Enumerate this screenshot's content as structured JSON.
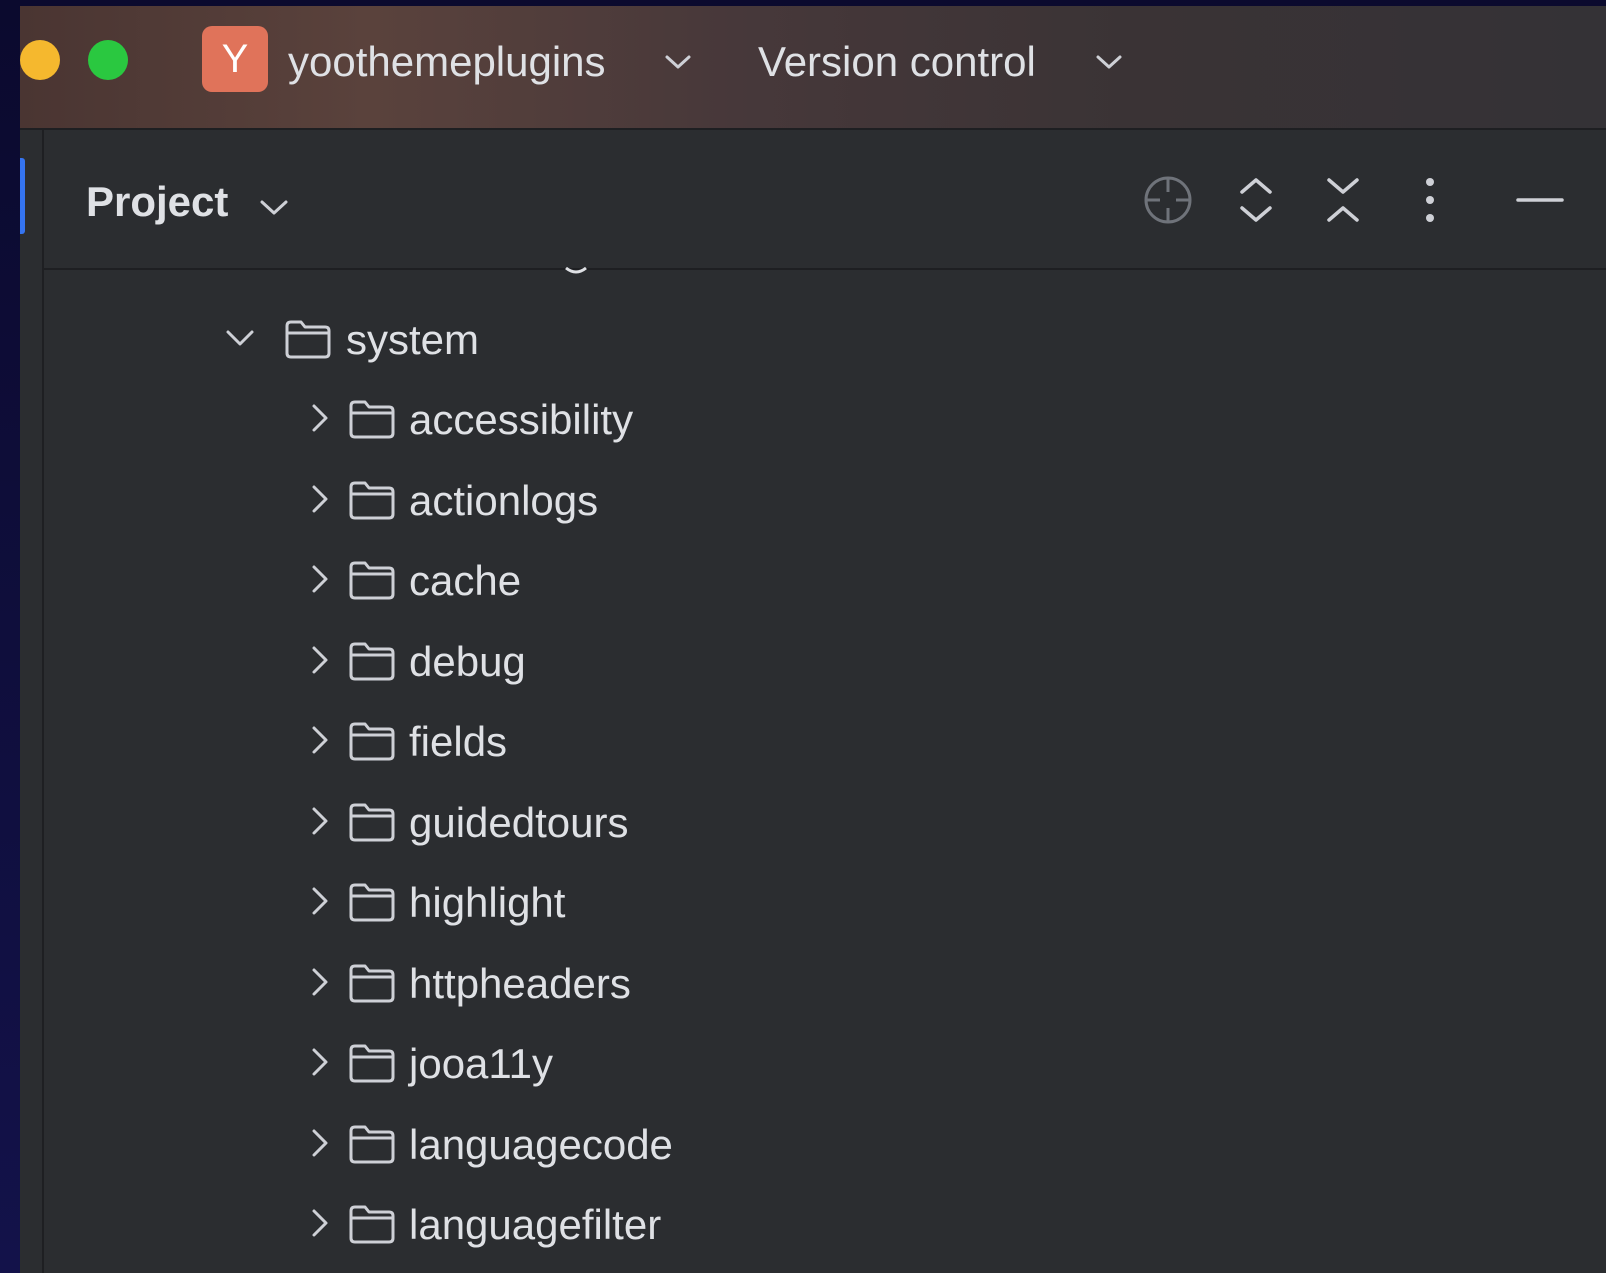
{
  "colors": {
    "window_bg": "#2b2d30",
    "text": "#dfe1e5",
    "icon": "#ced0d6",
    "badge": "#e0735a",
    "accent": "#3574f0",
    "traffic_yellow": "#f5b82e",
    "traffic_green": "#2ac840"
  },
  "titlebar": {
    "project_initial": "Y",
    "project_name": "yoothemeplugins",
    "project_chevron_icon": "chevron-down-icon",
    "vcs_label": "Version control",
    "vcs_chevron_icon": "chevron-down-icon"
  },
  "panel": {
    "title": "Project",
    "title_chevron_icon": "chevron-down-icon",
    "actions": [
      {
        "name": "locate-icon",
        "tooltip": ""
      },
      {
        "name": "expand-all-icon",
        "tooltip": ""
      },
      {
        "name": "collapse-all-icon",
        "tooltip": ""
      },
      {
        "name": "more-options-icon",
        "tooltip": ""
      },
      {
        "name": "minimize-icon",
        "tooltip": ""
      }
    ]
  },
  "tree": {
    "parent": {
      "label": "system",
      "expanded": true,
      "icon": "folder-icon"
    },
    "children": [
      {
        "label": "accessibility",
        "expanded": false
      },
      {
        "label": "actionlogs",
        "expanded": false
      },
      {
        "label": "cache",
        "expanded": false
      },
      {
        "label": "debug",
        "expanded": false
      },
      {
        "label": "fields",
        "expanded": false
      },
      {
        "label": "guidedtours",
        "expanded": false
      },
      {
        "label": "highlight",
        "expanded": false
      },
      {
        "label": "httpheaders",
        "expanded": false
      },
      {
        "label": "jooa11y",
        "expanded": false
      },
      {
        "label": "languagecode",
        "expanded": false
      },
      {
        "label": "languagefilter",
        "expanded": false
      }
    ]
  }
}
